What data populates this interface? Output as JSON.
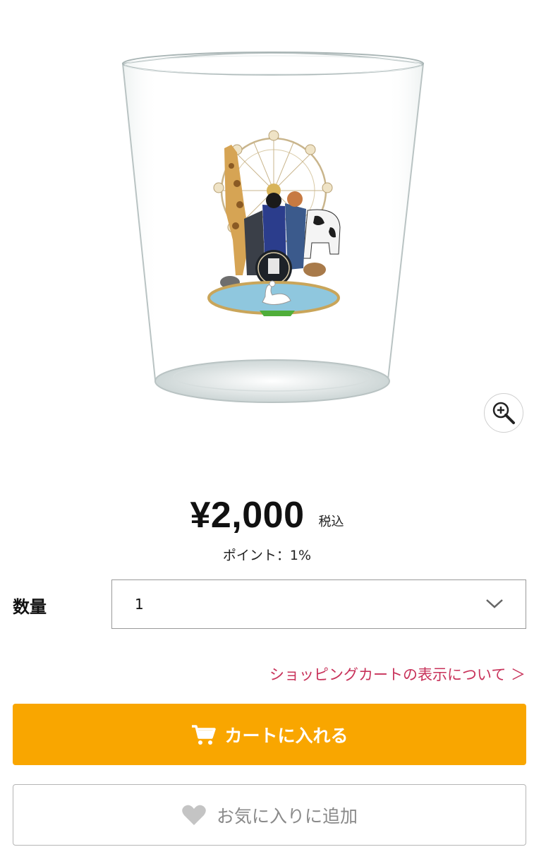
{
  "product": {
    "image_alt": "glass"
  },
  "price": {
    "amount": "¥2,000",
    "tax_label": "税込",
    "points": "ポイント：1%"
  },
  "quantity": {
    "label": "数量",
    "selected": "1"
  },
  "links": {
    "cart_info": "ショッピングカートの表示について ＞"
  },
  "buttons": {
    "add_to_cart": "カートに入れる",
    "add_to_favorites": "お気に入りに追加"
  },
  "colors": {
    "accent": "#f9a600",
    "link": "#c8325a",
    "favorite_text": "#8a8a8a"
  },
  "icons": {
    "zoom": "zoom-in-icon",
    "cart": "cart-icon",
    "heart": "heart-icon",
    "chevron": "chevron-down-icon"
  }
}
